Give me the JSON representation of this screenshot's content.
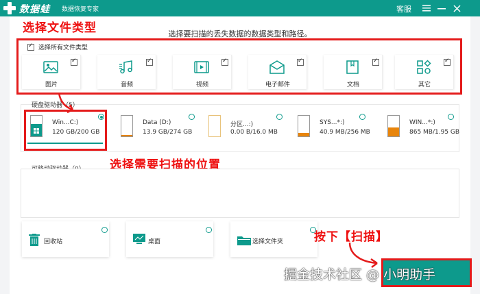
{
  "titlebar": {
    "app_name": "数据蛙",
    "app_subtitle": "数据恢复专家",
    "service": "客服",
    "menu_icon": "menu-icon",
    "minimize_icon": "minimize-icon",
    "close_icon": "close-icon"
  },
  "heading": "选择要扫描的丢失数据的数据类型和路径。",
  "annotations": {
    "select_type": "选择文件类型",
    "select_location": "选择需要扫描的位置",
    "press_scan": "按下【扫描】"
  },
  "file_types": {
    "select_all_label": "选择所有文件类型",
    "select_all_checked": true,
    "items": [
      {
        "label": "图片",
        "icon": "image-icon",
        "checked": true
      },
      {
        "label": "音频",
        "icon": "music-icon",
        "checked": true
      },
      {
        "label": "视频",
        "icon": "video-icon",
        "checked": true
      },
      {
        "label": "电子邮件",
        "icon": "mail-icon",
        "checked": true
      },
      {
        "label": "文档",
        "icon": "document-icon",
        "checked": true
      },
      {
        "label": "其它",
        "icon": "other-icon",
        "checked": true
      }
    ]
  },
  "hard_drives": {
    "title": "硬盘驱动器（5）",
    "items": [
      {
        "name": "Win...C:)",
        "size": "120 GB/200 GB",
        "selected": true,
        "fill": 0.6
      },
      {
        "name": "Data (D:)",
        "size": "13.9 GB/274 GB",
        "selected": false,
        "fill": 0.05
      },
      {
        "name": "分区...:)",
        "size": "0.00  B/16.0 MB",
        "selected": false,
        "fill": 0
      },
      {
        "name": "SYS...*:)",
        "size": "40.9 MB/256 MB",
        "selected": false,
        "fill": 0.16
      },
      {
        "name": "WIN...*:)",
        "size": "865 MB/1.95 GB",
        "selected": false,
        "fill": 0.44
      }
    ]
  },
  "removable": {
    "title": "可移动驱动器（0）"
  },
  "locations": [
    {
      "label": "回收站",
      "icon": "recycle-bin-icon"
    },
    {
      "label": "桌面",
      "icon": "desktop-icon"
    },
    {
      "label": "选择文件夹",
      "icon": "folder-icon"
    }
  ],
  "watermark": "掘金技术社区 @ 小明助手",
  "colors": {
    "accent": "#0d9a8c",
    "annotation": "#e41b1b",
    "drive_fill": "#e8850c"
  }
}
